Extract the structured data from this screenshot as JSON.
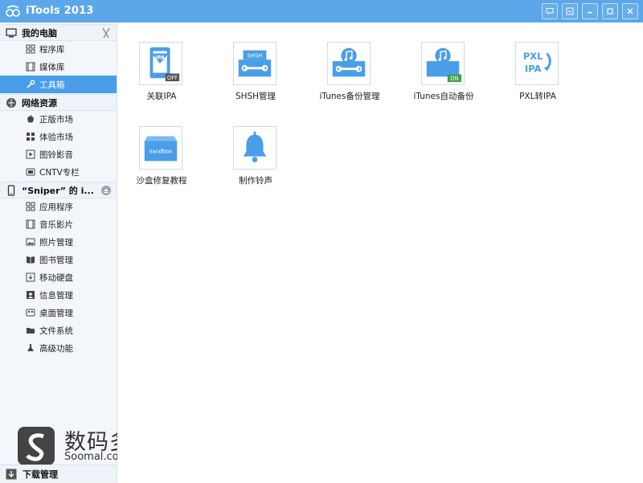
{
  "app": {
    "title": "iTools 2013"
  },
  "sidebar": {
    "my_computer": {
      "label": "我的电脑",
      "items": [
        {
          "label": "程序库",
          "icon": "grid-icon"
        },
        {
          "label": "媒体库",
          "icon": "film-icon"
        },
        {
          "label": "工具箱",
          "icon": "wrench-icon",
          "active": true
        }
      ]
    },
    "network": {
      "label": "网络资源",
      "items": [
        {
          "label": "正版市场",
          "icon": "apple-icon"
        },
        {
          "label": "体验市场",
          "icon": "grid-icon"
        },
        {
          "label": "图铃影音",
          "icon": "play-icon"
        },
        {
          "label": "CNTV专栏",
          "icon": "tv-icon"
        }
      ]
    },
    "device": {
      "label": "“Sniper” 的 i...",
      "items": [
        {
          "label": "应用程序",
          "icon": "grid-icon"
        },
        {
          "label": "音乐影片",
          "icon": "film-icon"
        },
        {
          "label": "照片管理",
          "icon": "photo-icon"
        },
        {
          "label": "图书管理",
          "icon": "book-icon"
        },
        {
          "label": "移动硬盘",
          "icon": "disk-icon"
        },
        {
          "label": "信息管理",
          "icon": "contact-icon"
        },
        {
          "label": "桌面管理",
          "icon": "desktop-icon"
        },
        {
          "label": "文件系统",
          "icon": "folder-icon"
        },
        {
          "label": "高级功能",
          "icon": "flask-icon"
        }
      ]
    },
    "download": {
      "label": "下载管理"
    }
  },
  "watermark": {
    "cn": "数码多",
    "en": "Soomal.com"
  },
  "tools": [
    {
      "label": "关联IPA",
      "icon": "ipa-off-icon",
      "badge": "OFF"
    },
    {
      "label": "SHSH管理",
      "icon": "shsh-box-icon",
      "badge_text": "SHSH"
    },
    {
      "label": "iTunes备份管理",
      "icon": "itunes-backup-icon"
    },
    {
      "label": "iTunes自动备份",
      "icon": "itunes-auto-backup-icon",
      "badge": "ON"
    },
    {
      "label": "PXL转IPA",
      "icon": "pxl-ipa-icon",
      "text1": "PXL",
      "text2": "IPA"
    },
    {
      "label": "沙盒修复教程",
      "icon": "sandbox-icon",
      "badge_text": "sandbox"
    },
    {
      "label": "制作铃声",
      "icon": "bell-icon"
    }
  ],
  "colors": {
    "titlebar": "#5ba7e9",
    "accent": "#4a9ee8",
    "sidebar_bg": "#f3f7fb"
  }
}
